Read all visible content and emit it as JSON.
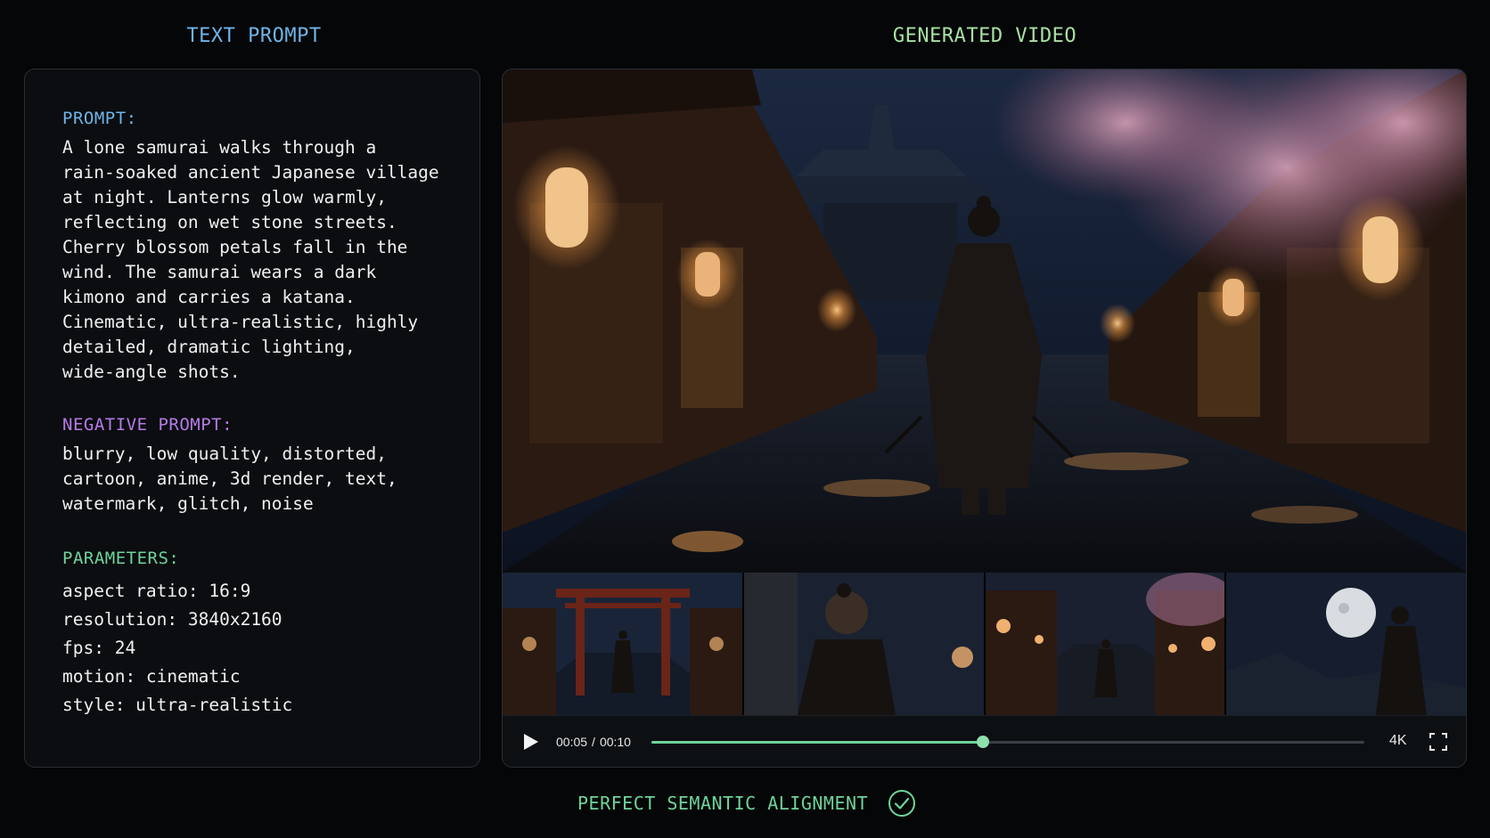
{
  "left_panel": {
    "title": "TEXT PROMPT",
    "prompt_label": "PROMPT:",
    "prompt_text": "A lone samurai walks through a\nrain-soaked ancient Japanese village\nat night. Lanterns glow warmly,\nreflecting on wet stone streets.\nCherry blossom petals fall in the\nwind. The samurai wears a dark\nkimono and carries a katana.\nCinematic, ultra-realistic, highly\ndetailed, dramatic lighting,\nwide-angle shots.",
    "negative_label": "NEGATIVE PROMPT:",
    "negative_text": "blurry, low quality, distorted,\ncartoon, anime, 3d render, text,\nwatermark, glitch, noise",
    "parameters_label": "PARAMETERS:",
    "parameters": [
      "aspect ratio: 16:9",
      "resolution: 3840x2160",
      "fps: 24",
      "motion: cinematic",
      "style: ultra-realistic"
    ]
  },
  "right_panel": {
    "title": "GENERATED VIDEO",
    "main_frame_icon": "samurai-street-scene",
    "thumbnails": [
      {
        "icon": "torii-gate-scene"
      },
      {
        "icon": "samurai-closeup-scene"
      },
      {
        "icon": "lantern-street-scene"
      },
      {
        "icon": "moonlit-samurai-scene"
      }
    ],
    "player": {
      "current_time": "00:05",
      "separator": "/",
      "duration": "00:10",
      "progress": 0.465,
      "quality": "4K"
    }
  },
  "footer": {
    "alignment_text": "PERFECT SEMANTIC ALIGNMENT"
  },
  "colors": {
    "prompt_label": "#6fb4e8",
    "negative_label": "#b77be8",
    "params_label": "#6fd39a",
    "accent_green": "#6fd39a"
  }
}
